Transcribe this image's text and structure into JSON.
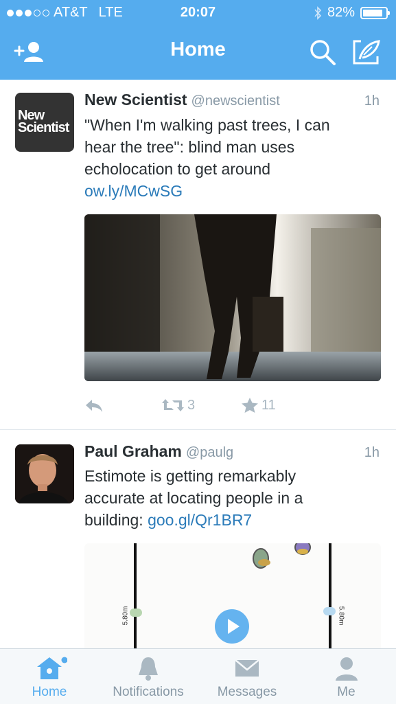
{
  "status_bar": {
    "carrier": "AT&T",
    "network": "LTE",
    "time": "20:07",
    "battery": "82%",
    "battery_level": 0.82
  },
  "nav": {
    "title": "Home",
    "left_icon": "add-user-icon",
    "search_icon": "search-icon",
    "compose_icon": "compose-icon"
  },
  "tweets": [
    {
      "name": "New Scientist",
      "handle": "@newscientist",
      "time": "1h",
      "avatar_text_1": "New",
      "avatar_text_2": "Scientist",
      "text": "\"When I'm walking past trees, I can hear the tree\": blind man uses echolocation to get around ",
      "link": "ow.ly/MCwSG",
      "retweets": "3",
      "favorites": "11"
    },
    {
      "name": "Paul Graham",
      "handle": "@paulg",
      "time": "1h",
      "text": "Estimote is getting remarkably accurate at locating people in a building: ",
      "link": "goo.gl/Qr1BR7",
      "media_label_left": "5.80m",
      "media_label_right": "5.80m"
    }
  ],
  "tabs": [
    {
      "label": "Home",
      "icon": "home-icon",
      "active": true
    },
    {
      "label": "Notifications",
      "icon": "bell-icon",
      "active": false
    },
    {
      "label": "Messages",
      "icon": "envelope-icon",
      "active": false
    },
    {
      "label": "Me",
      "icon": "person-icon",
      "active": false
    }
  ],
  "colors": {
    "brand": "#55acee",
    "link": "#2b7bb9",
    "muted": "#8899a6"
  }
}
